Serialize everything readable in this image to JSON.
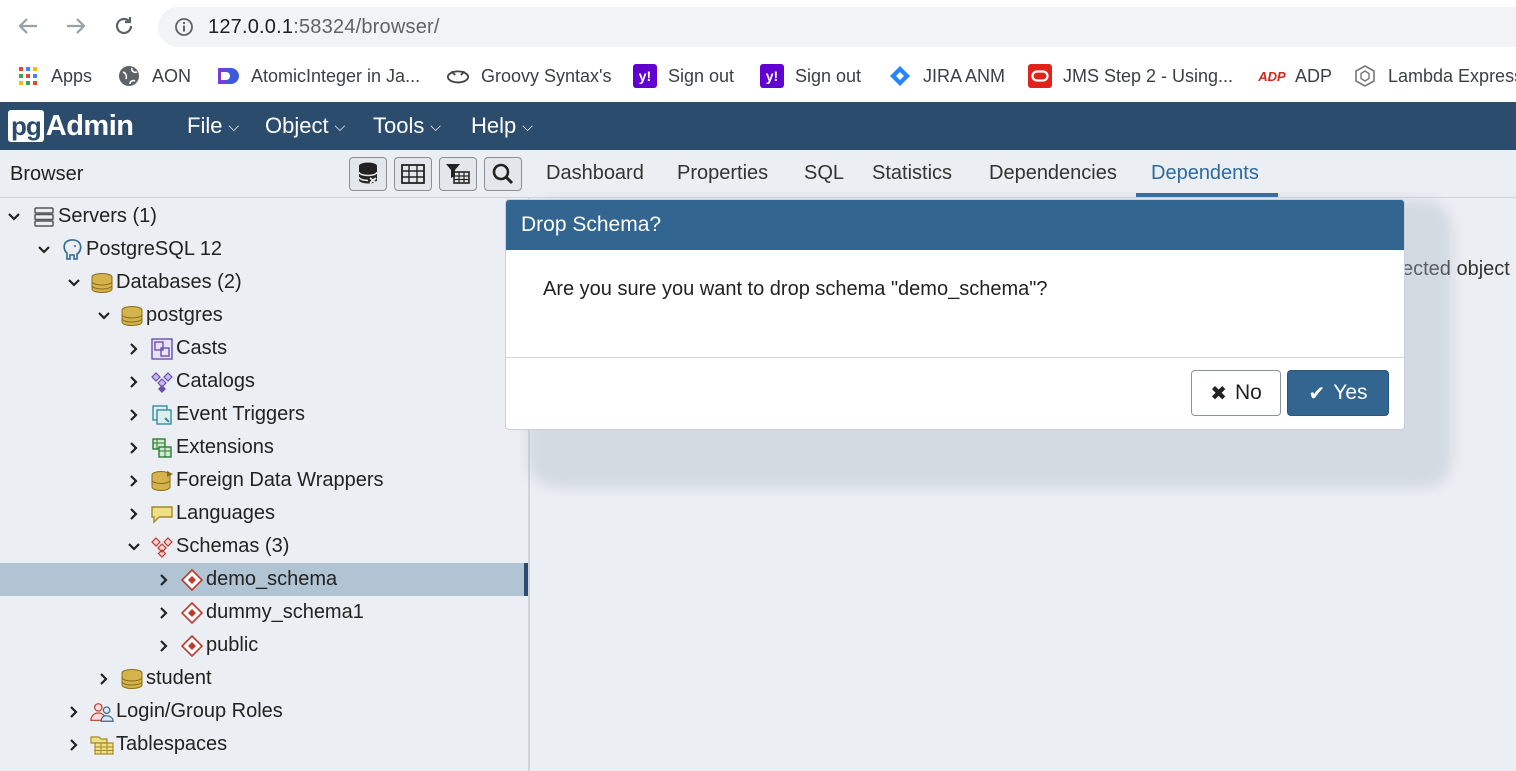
{
  "browser": {
    "url_host": "127.0.0.1",
    "url_rest": ":58324/browser/",
    "bookmarks": [
      {
        "label": "Apps",
        "icon": "apps-grid-icon"
      },
      {
        "label": "AON",
        "icon": "globe-icon"
      },
      {
        "label": "AtomicInteger in Ja...",
        "icon": "jetbrains-icon"
      },
      {
        "label": "Groovy Syntax's",
        "icon": "groovy-icon"
      },
      {
        "label": "Sign out",
        "icon": "yahoo-icon"
      },
      {
        "label": "Sign out",
        "icon": "yahoo-icon"
      },
      {
        "label": "JIRA ANM",
        "icon": "jira-icon"
      },
      {
        "label": "JMS Step 2 - Using...",
        "icon": "oracle-icon"
      },
      {
        "label": "ADP",
        "icon": "adp-icon"
      },
      {
        "label": "Lambda Express",
        "icon": "lambda-icon"
      }
    ]
  },
  "header": {
    "logo_pg": "pg",
    "logo_admin": "Admin",
    "menus": [
      "File",
      "Object",
      "Tools",
      "Help"
    ]
  },
  "sidebar": {
    "title": "Browser",
    "tree": [
      {
        "label": "Servers (1)",
        "icon": "servers-icon"
      },
      {
        "label": "PostgreSQL 12",
        "icon": "elephant-icon"
      },
      {
        "label": "Databases (2)",
        "icon": "databases-icon"
      },
      {
        "label": "postgres",
        "icon": "database-icon"
      },
      {
        "label": "Casts",
        "icon": "casts-icon"
      },
      {
        "label": "Catalogs",
        "icon": "catalogs-icon"
      },
      {
        "label": "Event Triggers",
        "icon": "event-triggers-icon"
      },
      {
        "label": "Extensions",
        "icon": "extensions-icon"
      },
      {
        "label": "Foreign Data Wrappers",
        "icon": "fdw-icon"
      },
      {
        "label": "Languages",
        "icon": "languages-icon"
      },
      {
        "label": "Schemas (3)",
        "icon": "schemas-icon"
      },
      {
        "label": "demo_schema",
        "icon": "schema-icon"
      },
      {
        "label": "dummy_schema1",
        "icon": "schema-icon"
      },
      {
        "label": "public",
        "icon": "schema-icon"
      },
      {
        "label": "student",
        "icon": "database-icon"
      },
      {
        "label": "Login/Group Roles",
        "icon": "roles-icon"
      },
      {
        "label": "Tablespaces",
        "icon": "tablespaces-icon"
      }
    ]
  },
  "main": {
    "tabs": [
      "Dashboard",
      "Properties",
      "SQL",
      "Statistics",
      "Dependencies",
      "Dependents"
    ],
    "active_tab": "Dependents",
    "background_text": "ected object"
  },
  "dialog": {
    "title": "Drop Schema?",
    "message": "Are you sure you want to drop schema \"demo_schema\"?",
    "no_label": "No",
    "yes_label": "Yes"
  },
  "colors": {
    "header": "#2c4c6e",
    "dialog_header": "#326690",
    "active_tab": "#2c6aa0",
    "selected_row": "#b0c4d4"
  }
}
